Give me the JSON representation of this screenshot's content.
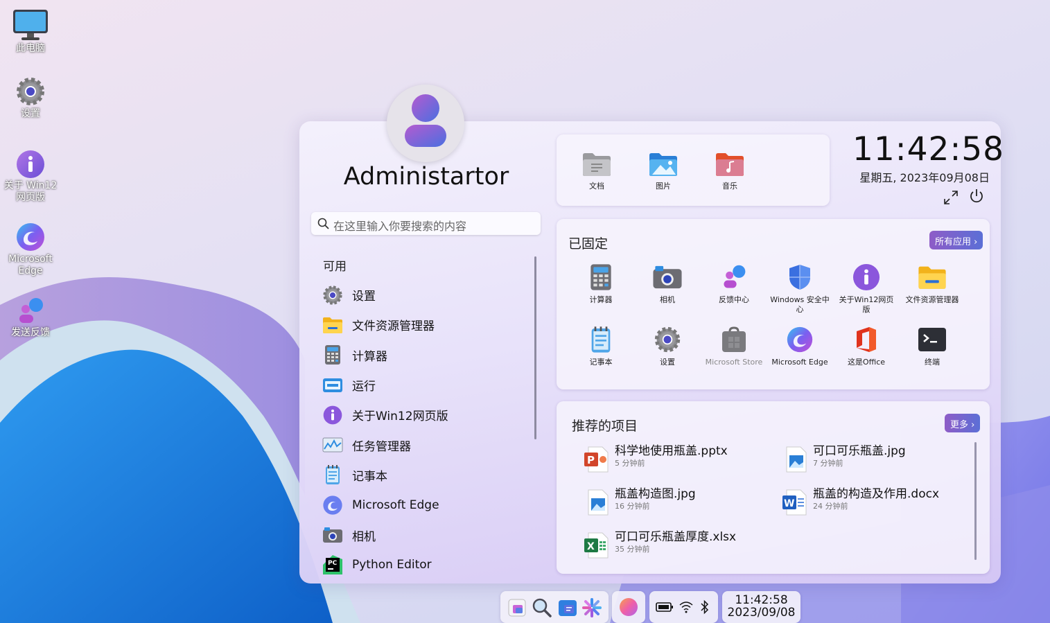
{
  "desktop": {
    "icons": [
      {
        "label": "此电脑",
        "icon": "monitor-icon"
      },
      {
        "label": "设置",
        "icon": "gear-icon"
      },
      {
        "label_line1": "关于 Win12",
        "label_line2": "网页版",
        "icon": "info-icon"
      },
      {
        "label_line1": "Microsoft",
        "label_line2": "Edge",
        "icon": "edge-icon"
      },
      {
        "label": "发送反馈",
        "icon": "feedback-icon"
      }
    ]
  },
  "start_menu": {
    "user": {
      "name": "Administartor"
    },
    "search": {
      "placeholder": "在这里输入你要搜索的内容"
    },
    "available": {
      "title": "可用",
      "apps": [
        {
          "label": "设置",
          "icon": "gear-icon"
        },
        {
          "label": "文件资源管理器",
          "icon": "folder-icon"
        },
        {
          "label": "计算器",
          "icon": "calculator-icon"
        },
        {
          "label": "运行",
          "icon": "run-icon"
        },
        {
          "label": "关于Win12网页版",
          "icon": "info-icon"
        },
        {
          "label": "任务管理器",
          "icon": "task-manager-icon"
        },
        {
          "label": "记事本",
          "icon": "notepad-icon"
        },
        {
          "label": "Microsoft Edge",
          "icon": "edge-icon"
        },
        {
          "label": "相机",
          "icon": "camera-icon"
        },
        {
          "label": "Python Editor",
          "icon": "pycharm-icon"
        }
      ]
    },
    "folders": [
      {
        "label": "文档",
        "icon": "documents-folder-icon"
      },
      {
        "label": "图片",
        "icon": "pictures-folder-icon"
      },
      {
        "label": "音乐",
        "icon": "music-folder-icon"
      }
    ],
    "clock": {
      "time": "11:42:58",
      "date": "星期五, 2023年09月08日"
    },
    "pinned": {
      "title": "已固定",
      "all_apps_label": "所有应用 ›",
      "apps": [
        {
          "line1": "计算器",
          "line2": "",
          "icon": "calculator-icon"
        },
        {
          "line1": "相机",
          "line2": "",
          "icon": "camera-icon"
        },
        {
          "line1": "反馈中心",
          "line2": "",
          "icon": "feedback-icon"
        },
        {
          "line1": "Windows 安全中",
          "line2": "心",
          "icon": "shield-icon"
        },
        {
          "line1": "关于Win12网页",
          "line2": "版",
          "icon": "info-icon"
        },
        {
          "line1": "文件资源管理器",
          "line2": "",
          "icon": "folder-icon"
        },
        {
          "line1": "记事本",
          "line2": "",
          "icon": "notepad-icon"
        },
        {
          "line1": "设置",
          "line2": "",
          "icon": "gear-icon"
        },
        {
          "line1": "Microsoft Store",
          "line2": "",
          "icon": "store-icon"
        },
        {
          "line1": "Microsoft Edge",
          "line2": "",
          "icon": "edge-icon"
        },
        {
          "line1": "这是Office",
          "line2": "",
          "icon": "office-icon"
        },
        {
          "line1": "终端",
          "line2": "",
          "icon": "terminal-icon"
        }
      ]
    },
    "recommended": {
      "title": "推荐的项目",
      "more_label": "更多 ›",
      "items": [
        {
          "name": "科学地使用瓶盖.pptx",
          "time": "5 分钟前",
          "icon": "powerpoint-icon"
        },
        {
          "name": "可口可乐瓶盖.jpg",
          "time": "7 分钟前",
          "icon": "image-file-icon"
        },
        {
          "name": "瓶盖构造图.jpg",
          "time": "16 分钟前",
          "icon": "image-file-icon"
        },
        {
          "name": "瓶盖的构造及作用.docx",
          "time": "24 分钟前",
          "icon": "word-icon"
        },
        {
          "name": "可口可乐瓶盖厚度.xlsx",
          "time": "35 分钟前",
          "icon": "excel-icon"
        }
      ]
    }
  },
  "taskbar": {
    "icons": [
      "explorer-icon",
      "search-icon",
      "widgets-icon",
      "copilot-icon",
      "profile-orb-icon",
      "battery-icon",
      "wifi-icon",
      "bluetooth-icon"
    ],
    "clock": {
      "time": "11:42:58",
      "date": "2023/09/08"
    }
  },
  "colors": {
    "accent_gradient_start": "#8e5cc7",
    "accent_gradient_end": "#5b6fd6",
    "wallpaper_blue": "#1e7fe0"
  }
}
